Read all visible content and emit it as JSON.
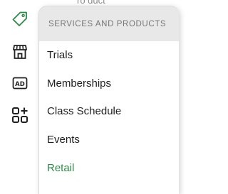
{
  "rail": {
    "items": [
      {
        "icon": "tag-icon",
        "active": true
      },
      {
        "icon": "storefront-icon"
      },
      {
        "icon": "ad-icon",
        "label": "AD"
      },
      {
        "icon": "apps-add-icon"
      }
    ],
    "active_color": "#2e8b47",
    "icon_color": "#1f1f1f"
  },
  "flyout": {
    "header": "SERVICES AND PRODUCTS",
    "items": [
      {
        "label": "Trials"
      },
      {
        "label": "Memberships"
      },
      {
        "label": "Class Schedule"
      },
      {
        "label": "Events"
      },
      {
        "label": "Retail",
        "active": true
      }
    ]
  },
  "background_fragment": "ro duct"
}
